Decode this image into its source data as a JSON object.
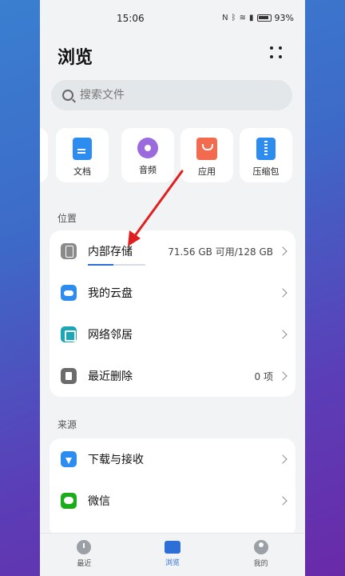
{
  "status": {
    "time": "15:06",
    "battery": "93%",
    "icons": [
      "nfc-icon",
      "bluetooth-icon",
      "wifi-icon",
      "signal-icon",
      "battery-icon"
    ]
  },
  "header": {
    "title": "浏览"
  },
  "search": {
    "placeholder": "搜索文件"
  },
  "categories": [
    {
      "label": "文档",
      "icon": "document-icon",
      "color": "#2d8cf0"
    },
    {
      "label": "音频",
      "icon": "audio-icon",
      "color": "#9b6bde"
    },
    {
      "label": "应用",
      "icon": "app-bag-icon",
      "color": "#f26b4f"
    },
    {
      "label": "压缩包",
      "icon": "zip-icon",
      "color": "#2d8cf0"
    }
  ],
  "location": {
    "title": "位置",
    "items": [
      {
        "label": "内部存储",
        "value": "71.56 GB 可用/128 GB",
        "icon": "phone-icon",
        "usage_fraction": 0.44
      },
      {
        "label": "我的云盘",
        "value": "",
        "icon": "cloud-icon"
      },
      {
        "label": "网络邻居",
        "value": "",
        "icon": "network-icon"
      },
      {
        "label": "最近删除",
        "value": "0 项",
        "icon": "trash-icon"
      }
    ]
  },
  "source": {
    "title": "来源",
    "items": [
      {
        "label": "下载与接收",
        "icon": "download-icon"
      },
      {
        "label": "微信",
        "icon": "wechat-icon"
      }
    ]
  },
  "bottom_nav": [
    {
      "label": "最近",
      "icon": "clock-icon",
      "active": false
    },
    {
      "label": "浏览",
      "icon": "folder-icon",
      "active": true
    },
    {
      "label": "我的",
      "icon": "user-icon",
      "active": false
    }
  ],
  "accent_color": "#2d6fd6",
  "annotation_color": "#e02020"
}
